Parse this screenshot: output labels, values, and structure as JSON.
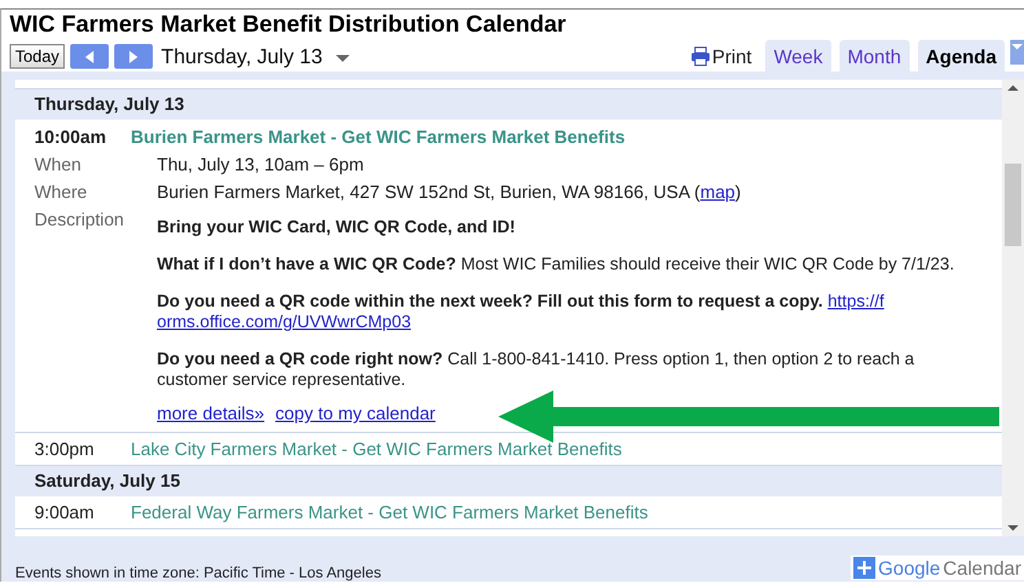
{
  "window": {
    "title": "WIC Farmers Market Benefit Distribution Calendar"
  },
  "toolbar": {
    "today": "Today",
    "date": "Thursday, July 13",
    "print": "Print"
  },
  "tabs": [
    {
      "label": "Week",
      "selected": false
    },
    {
      "label": "Month",
      "selected": false
    },
    {
      "label": "Agenda",
      "selected": true
    }
  ],
  "agenda": [
    {
      "kind": "day",
      "label": "Thursday, July 13"
    },
    {
      "kind": "expanded",
      "time": "10:00am",
      "title": "Burien Farmers Market - Get WIC Farmers Market Benefits",
      "details": [
        {
          "label": "When",
          "value": "Thu, July 13, 10am – 6pm"
        },
        {
          "label": "Where",
          "value": "Burien Farmers Market, 427 SW 152nd St, Burien, WA 98166, USA (",
          "link": "map",
          "after": ")"
        }
      ],
      "description_label": "Description",
      "description": [
        {
          "text": "Bring your WIC Card, WIC QR Code, and ID!"
        },
        {
          "text": "**What if I don’t have a WIC QR Code?** Most WIC Families should receive their WIC QR Code by 7/1/23."
        },
        {
          "text": "**Do you need a QR code within the next week? Fill out this form to request a copy.**",
          "link": [
            "https://f",
            "orms.office.com/g/UVWwrCMp03"
          ]
        },
        {
          "text": "**Do you need a QR code right now?**   Call 1-800-841-1410. Press option 1, then option 2 to reach a customer service representative."
        }
      ],
      "actions": [
        "more details»",
        "copy to my calendar"
      ]
    },
    {
      "kind": "event",
      "time": "3:00pm",
      "title": "Lake City Farmers Market - Get WIC Farmers Market Benefits"
    },
    {
      "kind": "day",
      "label": "Saturday, July 15"
    },
    {
      "kind": "event",
      "time": "9:00am",
      "title": "Federal Way Farmers Market - Get WIC Farmers Market Benefits"
    }
  ],
  "footer": {
    "timezone": "Events shown in time zone: Pacific Time - Los Angeles",
    "badge": [
      "Google",
      "Calendar"
    ]
  }
}
